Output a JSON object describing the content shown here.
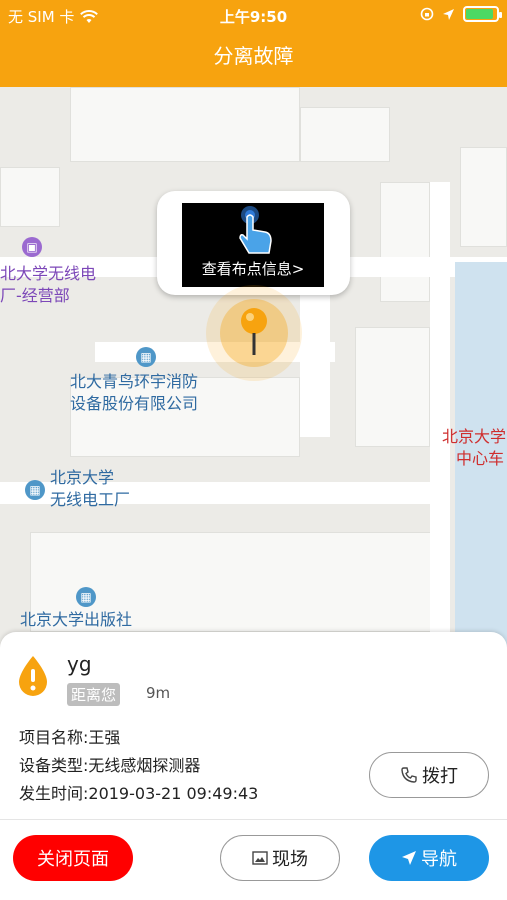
{
  "status_bar": {
    "carrier": "无 SIM 卡",
    "time": "上午9:50"
  },
  "header": {
    "title": "分离故障"
  },
  "map": {
    "callout_text": "查看布点信息>",
    "pois": {
      "radio_sales_line1": "北大学无线电",
      "radio_sales_line2": "厂-经营部",
      "fire_line1": "北大青鸟环宇消防",
      "fire_line2": "设备股份有限公司",
      "radio_factory_line1": "北京大学",
      "radio_factory_line2": "无线电工厂",
      "press": "北京大学出版社",
      "center_line1": "北京大学",
      "center_line2": "中心车"
    }
  },
  "card": {
    "name": "yg",
    "distance_label": "距离您",
    "distance_value": "9m",
    "project": "项目名称:王强",
    "device_type": "设备类型:无线感烟探测器",
    "time": "发生时间:2019-03-21 09:49:43",
    "call_label": "拨打",
    "close_label": "关闭页面",
    "scene_label": "现场",
    "nav_label": "导航"
  },
  "colors": {
    "header": "#f7a30f",
    "close_button": "#ff0000",
    "nav_button": "#1e96e6"
  }
}
